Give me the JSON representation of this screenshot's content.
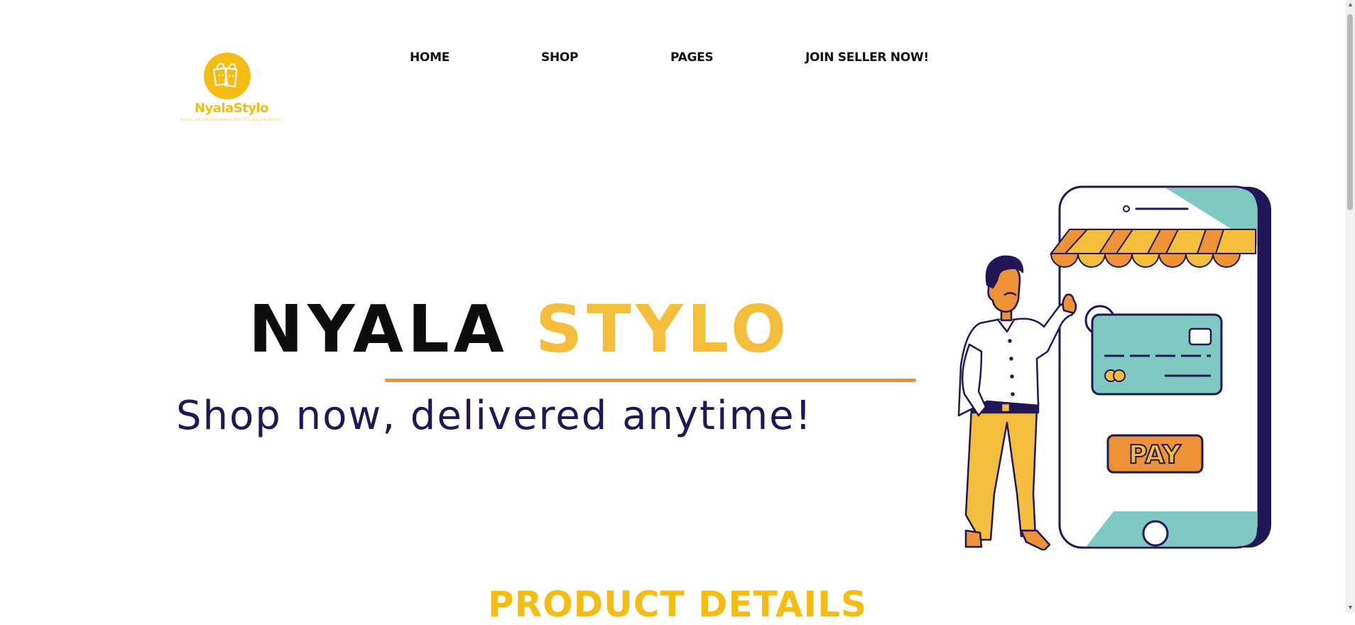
{
  "header": {
    "logo": {
      "name": "NyalaStylo",
      "tagline": "NYALA DALAM INDONESIA BERARTI DALAM KAYUTI"
    },
    "nav": [
      {
        "label": "HOME"
      },
      {
        "label": "SHOP"
      },
      {
        "label": "PAGES"
      },
      {
        "label": "JOIN SELLER NOW!"
      }
    ]
  },
  "hero": {
    "title_part1": "NYALA",
    "title_part2": "STYLO",
    "subtitle": "Shop now, delivered anytime!",
    "illustration": {
      "icon": "online-shop-payment-illustration",
      "pay_button_label": "PAY"
    }
  },
  "section": {
    "title": "PRODUCT DETAILS"
  },
  "colors": {
    "brand_yellow": "#f5bd12",
    "accent_orange": "#ed9237",
    "navy": "#1f1757",
    "teal": "#7ecac3"
  }
}
